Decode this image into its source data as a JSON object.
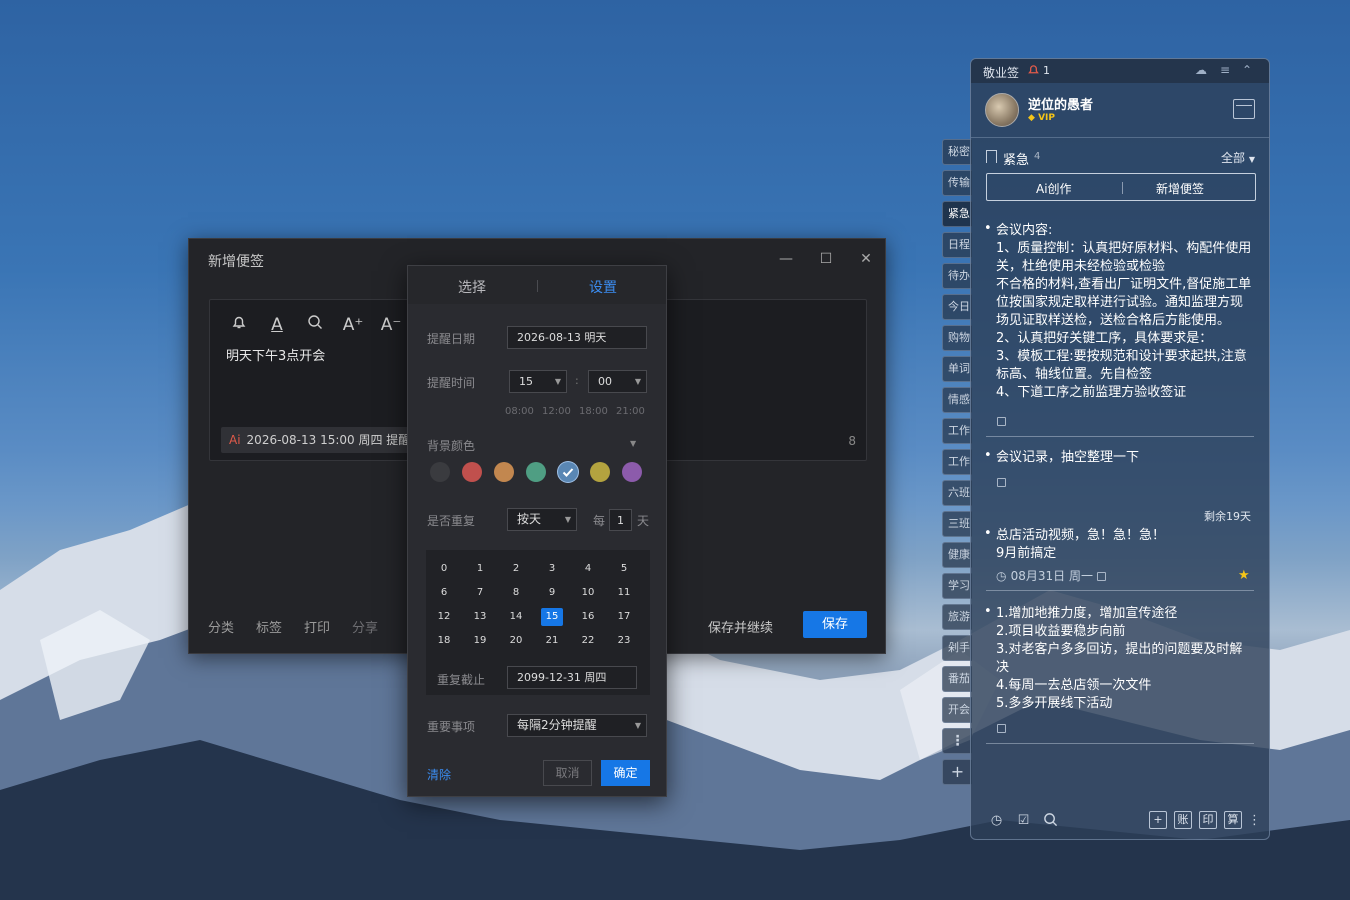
{
  "editor": {
    "title": "新增便签",
    "window_controls": {
      "minimize": "—",
      "maximize": "☐",
      "close": "✕"
    },
    "toolbar_icons": [
      "bell-icon",
      "text-color-icon",
      "search-icon",
      "font-increase-icon",
      "font-decrease-icon"
    ],
    "toolbar_glyphs": {
      "text_color": "A",
      "inc": "A⁺",
      "dec": "A⁻"
    },
    "content": "明天下午3点开会",
    "reminder_bar": {
      "ai": "Ai",
      "text": "2026-08-13 15:00 周四 提醒"
    },
    "char_count": "8",
    "bottom_actions": [
      "分类",
      "标签",
      "打印",
      "分享"
    ],
    "save_continue": "保存并继续",
    "save": "保存"
  },
  "reminder_popup": {
    "tabs": [
      "选择",
      "设置"
    ],
    "active_tab": "设置",
    "date_label": "提醒日期",
    "date_value": "2026-08-13  明天",
    "time_label": "提醒时间",
    "hour": "15",
    "minute": "00",
    "time_separator": ":",
    "quick_times": [
      "08:00",
      "12:00",
      "18:00",
      "21:00"
    ],
    "bg_color_label": "背景颜色",
    "colors": [
      "#3a3b3f",
      "#c0504d",
      "#c2874f",
      "#4f9e83",
      "#5a87b4",
      "#b3a33f",
      "#8c5bab"
    ],
    "selected_color_index": 4,
    "repeat_label": "是否重复",
    "repeat_mode": "按天",
    "every_label": "每",
    "every_value": "1",
    "every_unit": "天",
    "calendar_days": [
      [
        "0",
        "1",
        "2",
        "3",
        "4",
        "5"
      ],
      [
        "6",
        "7",
        "8",
        "9",
        "10",
        "11"
      ],
      [
        "12",
        "13",
        "14",
        "15",
        "16",
        "17"
      ],
      [
        "18",
        "19",
        "20",
        "21",
        "22",
        "23"
      ]
    ],
    "selected_day": "15",
    "repeat_end_label": "重复截止",
    "repeat_end_value": "2099-12-31  周四",
    "important_label": "重要事项",
    "important_value": "每隔2分钟提醒",
    "clear": "清除",
    "cancel": "取消",
    "confirm": "确定"
  },
  "side_tabs": [
    "秘密",
    "传输",
    "紧急",
    "日程",
    "待办",
    "今日",
    "购物",
    "单词",
    "情感",
    "工作",
    "工作",
    "六班",
    "三班",
    "健康",
    "学习",
    "旅游",
    "剁手",
    "番茄",
    "开会"
  ],
  "side_active": "紧急",
  "side_more": "⋮",
  "side_add": "+",
  "panel": {
    "title": "敬业签",
    "bell_count": "1",
    "user_name": "逆位的愚者",
    "vip": "VIP",
    "category": "紧急",
    "category_count": "4",
    "filter": "全部",
    "ai_create": "Ai创作",
    "new_note": "新增便签",
    "notes": [
      {
        "lines": [
          "会议内容:",
          "1、质量控制：认真把好原材料、构配件使用关，杜绝使用未经检验或检验",
          "不合格的材料,查看出厂证明文件,督促施工单位按国家规定取样进行试验。通知监理方现场见证取样送检，送检合格后方能使用。",
          "2、认真把好关键工序，具体要求是：",
          "3、模板工程:要按规范和设计要求起拱,注意标高、轴线位置。先自检签",
          "4、下道工序之前监理方验收签证"
        ]
      },
      {
        "lines": [
          "会议记录，抽空整理一下"
        ]
      },
      {
        "remaining": "剩余19天",
        "lines": [
          "总店活动视频，急！急！急！",
          "9月前搞定"
        ],
        "date": "08月31日 周一"
      },
      {
        "lines": [
          "1.增加地推力度，增加宣传途径",
          "2.项目收益要稳步向前",
          "3.对老客户多多回访，提出的问题要及时解决",
          "4.每周一去总店领一次文件",
          "5.多多开展线下活动"
        ]
      }
    ],
    "bottom_square_icons": [
      "+",
      "账",
      "印",
      "算"
    ]
  }
}
